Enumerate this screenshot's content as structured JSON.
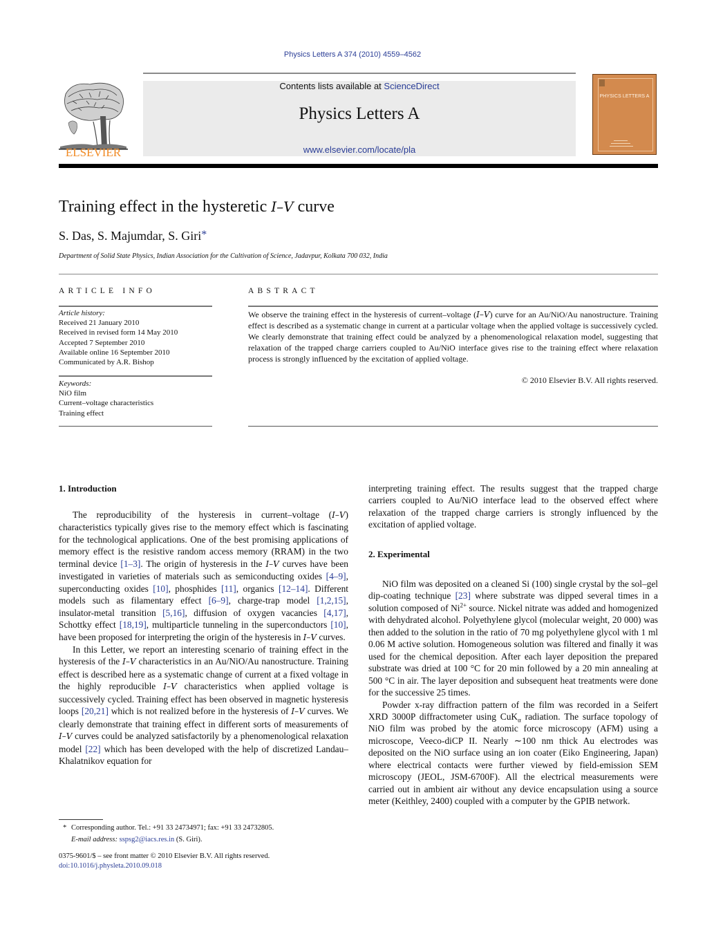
{
  "header": {
    "journal_ref": "Physics Letters A 374 (2010) 4559–4562",
    "contents_prefix": "Contents lists available at ",
    "contents_link": "ScienceDirect",
    "journal_title": "Physics Letters A",
    "journal_url": "www.elsevier.com/locate/pla",
    "publisher_logo_text": "ELSEVIER",
    "cover_title": "PHYSICS LETTERS A",
    "colors": {
      "link": "#2a3d96",
      "publisher_orange": "#f08a24",
      "cover": "#d38a4e",
      "header_band": "#ebebeb"
    }
  },
  "article": {
    "title_prefix": "Training effect in the hysteretic ",
    "title_math": "I–V",
    "title_suffix": " curve",
    "authors": "S. Das, S. Majumdar, S. Giri",
    "corresponding_mark": "*",
    "affiliation": "Department of Solid State Physics, Indian Association for the Cultivation of Science, Jadavpur, Kolkata 700 032, India"
  },
  "article_info": {
    "heading": "ARTICLE INFO",
    "history_label": "Article history:",
    "history": [
      "Received 21 January 2010",
      "Received in revised form 14 May 2010",
      "Accepted 7 September 2010",
      "Available online 16 September 2010",
      "Communicated by A.R. Bishop"
    ],
    "keywords_label": "Keywords:",
    "keywords": [
      "NiO film",
      "Current–voltage characteristics",
      "Training effect"
    ]
  },
  "abstract": {
    "heading": "ABSTRACT",
    "segments": [
      {
        "t": "We observe the training effect in the hysteresis of current–voltage ("
      },
      {
        "t": "I–V",
        "m": 1
      },
      {
        "t": ") curve for an Au/NiO/Au nanostructure. Training effect is described as a systematic change in current at a particular voltage when the applied voltage is successively cycled. We clearly demonstrate that training effect could be analyzed by a phenomenological relaxation model, suggesting that relaxation of the trapped charge carriers coupled to Au/NiO interface gives rise to the training effect where relaxation process is strongly influenced by the excitation of applied voltage."
      }
    ],
    "copyright": "© 2010 Elsevier B.V. All rights reserved."
  },
  "sections": {
    "intro_heading": "1.  Introduction",
    "intro_p1": [
      {
        "t": "The reproducibility of the hysteresis in current–voltage ("
      },
      {
        "t": "I–V",
        "m": 1
      },
      {
        "t": ") characteristics typically gives rise to the memory effect which is fascinating for the technological applications. One of the best promising applications of memory effect is the resistive random access memory (RRAM) in the two terminal device "
      },
      {
        "t": "[1–3]",
        "c": 1
      },
      {
        "t": ". The origin of hysteresis in the "
      },
      {
        "t": "I–V",
        "m": 1
      },
      {
        "t": " curves have been investigated in varieties of materials such as semiconducting oxides "
      },
      {
        "t": "[4–9]",
        "c": 1
      },
      {
        "t": ", superconducting oxides "
      },
      {
        "t": "[10]",
        "c": 1
      },
      {
        "t": ", phosphides "
      },
      {
        "t": "[11]",
        "c": 1
      },
      {
        "t": ", organics "
      },
      {
        "t": "[12–14]",
        "c": 1
      },
      {
        "t": ". Different models such as filamentary effect "
      },
      {
        "t": "[6–9]",
        "c": 1
      },
      {
        "t": ", charge-trap model "
      },
      {
        "t": "[1,2,15]",
        "c": 1
      },
      {
        "t": ", insulator-metal transition "
      },
      {
        "t": "[5,16]",
        "c": 1
      },
      {
        "t": ", diffusion of oxygen vacancies "
      },
      {
        "t": "[4,17]",
        "c": 1
      },
      {
        "t": ", Schottky effect "
      },
      {
        "t": "[18,19]",
        "c": 1
      },
      {
        "t": ", multiparticle tunneling in the superconductors "
      },
      {
        "t": "[10]",
        "c": 1
      },
      {
        "t": ", have been proposed for interpreting the origin of the hysteresis in "
      },
      {
        "t": "I–V",
        "m": 1
      },
      {
        "t": " curves."
      }
    ],
    "intro_p2": [
      {
        "t": "In this Letter, we report an interesting scenario of training effect in the hysteresis of the "
      },
      {
        "t": "I–V",
        "m": 1
      },
      {
        "t": " characteristics in an Au/NiO/Au nanostructure. Training effect is described here as a systematic change of current at a fixed voltage in the highly reproducible "
      },
      {
        "t": "I–V",
        "m": 1
      },
      {
        "t": " characteristics when applied voltage is successively cycled. Training effect has been observed in magnetic hysteresis loops "
      },
      {
        "t": "[20,21]",
        "c": 1
      },
      {
        "t": " which is not realized before in the hysteresis of "
      },
      {
        "t": "I–V",
        "m": 1
      },
      {
        "t": " curves. We clearly demonstrate that training effect in different sorts of measurements of "
      },
      {
        "t": "I–V",
        "m": 1
      },
      {
        "t": " curves could be analyzed satisfactorily by a phenomenological relaxation model "
      },
      {
        "t": "[22]",
        "c": 1
      },
      {
        "t": " which has been developed with the help of discretized Landau–Khalatnikov equation for"
      }
    ],
    "intro_p2_cont": [
      {
        "t": "interpreting training effect. The results suggest that the trapped charge carriers coupled to Au/NiO interface lead to the observed effect where relaxation of the trapped charge carriers is strongly influenced by the excitation of applied voltage."
      }
    ],
    "exp_heading": "2.  Experimental",
    "exp_p1": [
      {
        "t": "NiO film was deposited on a cleaned Si (100) single crystal by the sol–gel dip-coating technique "
      },
      {
        "t": "[23]",
        "c": 1
      },
      {
        "t": " where substrate was dipped several times in a solution composed of Ni"
      },
      {
        "t": "2+",
        "sup": 1
      },
      {
        "t": " source. Nickel nitrate was added and homogenized with dehydrated alcohol. Polyethylene glycol (molecular weight, 20 000) was then added to the solution in the ratio of 70 mg polyethylene glycol with 1 ml 0.06 M active solution. Homogeneous solution was filtered and finally it was used for the chemical deposition. After each layer deposition the prepared substrate was dried at 100 °C for 20 min followed by a 20 min annealing at 500 °C in air. The layer deposition and subsequent heat treatments were done for the successive 25 times."
      }
    ],
    "exp_p2": [
      {
        "t": "Powder x-ray diffraction pattern of the film was recorded in a Seifert XRD 3000P diffractometer using CuK"
      },
      {
        "t": "α",
        "sub": 1
      },
      {
        "t": " radiation. The surface topology of NiO film was probed by the atomic force microscopy (AFM) using a microscope, Veeco-diCP II. Nearly ∼100 nm thick Au electrodes was deposited on the NiO surface using an ion coater (Eiko Engineering, Japan) where electrical contacts were further viewed by field-emission SEM microscopy (JEOL, JSM-6700F). All the electrical measurements were carried out in ambient air without any device encapsulation using a source meter (Keithley, 2400) coupled with a computer by the GPIB network."
      }
    ]
  },
  "footnote": {
    "mark": "*",
    "corresponding": "Corresponding author. Tel.: +91 33 24734971; fax: +91 33 24732805.",
    "email_label": "E-mail address: ",
    "email": "sspsg2@iacs.res.in",
    "email_suffix": " (S. Giri)."
  },
  "front_matter": {
    "issn_line": "0375-9601/$ – see front matter  © 2010 Elsevier B.V. All rights reserved.",
    "doi": "doi:10.1016/j.physleta.2010.09.018"
  }
}
